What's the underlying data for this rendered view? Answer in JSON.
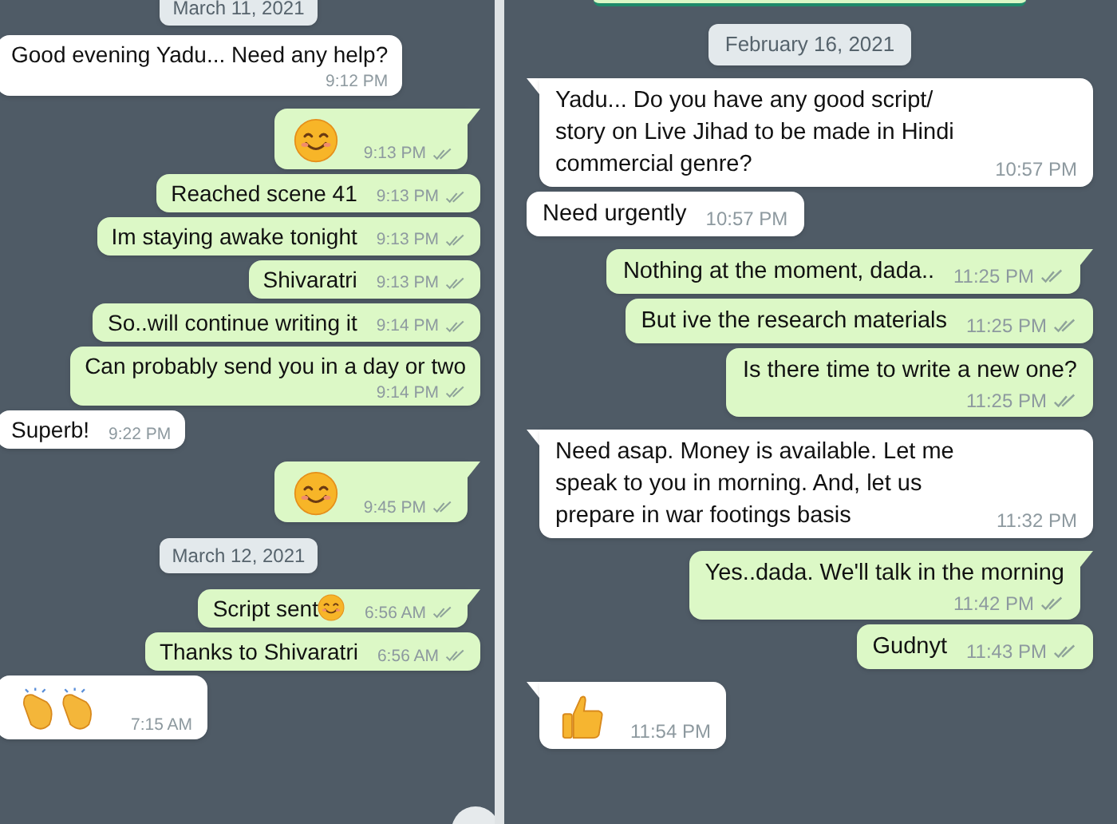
{
  "chats": [
    {
      "messages": [
        {
          "kind": "date",
          "text": "March 11, 2021"
        },
        {
          "kind": "text",
          "text": "Good evening Yadu... Need any help?",
          "time": "9:12 PM",
          "outgoing": false,
          "tail": false,
          "time_below": true
        },
        {
          "kind": "smiley",
          "time": "9:13 PM",
          "outgoing": true,
          "tail": true
        },
        {
          "kind": "text",
          "text": "Reached scene 41",
          "time": "9:13 PM",
          "outgoing": true,
          "tail": false,
          "time_below": false
        },
        {
          "kind": "text",
          "text": "Im staying awake tonight",
          "time": "9:13 PM",
          "outgoing": true,
          "tail": false,
          "time_below": false
        },
        {
          "kind": "text",
          "text": "Shivaratri",
          "time": "9:13 PM",
          "outgoing": true,
          "tail": false,
          "time_below": false
        },
        {
          "kind": "text",
          "text": "So..will continue writing it",
          "time": "9:14 PM",
          "outgoing": true,
          "tail": false,
          "time_below": false
        },
        {
          "kind": "text",
          "text": "Can probably send you in a day or two",
          "time": "9:14 PM",
          "outgoing": true,
          "tail": false,
          "time_below": true
        },
        {
          "kind": "text",
          "text": "Superb!",
          "time": "9:22 PM",
          "outgoing": false,
          "tail": false,
          "time_below": false
        },
        {
          "kind": "smiley",
          "time": "9:45 PM",
          "outgoing": true,
          "tail": true
        },
        {
          "kind": "date",
          "text": "March 12, 2021"
        },
        {
          "kind": "text",
          "text": "Script sent",
          "trailing_smiley": true,
          "time": "6:56 AM",
          "outgoing": true,
          "tail": true,
          "time_below": false
        },
        {
          "kind": "text",
          "text": "Thanks to Shivaratri",
          "time": "6:56 AM",
          "outgoing": true,
          "tail": false,
          "time_below": false
        },
        {
          "kind": "clapping",
          "time": "7:15 AM",
          "outgoing": false,
          "tail": false
        }
      ]
    },
    {
      "messages": [
        {
          "kind": "date",
          "text": "February 16, 2021"
        },
        {
          "kind": "text",
          "text": "Yadu... Do you have any good script/ story on Live Jihad to be made in Hindi commercial genre?",
          "time": "10:57 PM",
          "outgoing": false,
          "tail": true,
          "time_below": false
        },
        {
          "kind": "text",
          "text": "Need urgently",
          "time": "10:57 PM",
          "outgoing": false,
          "tail": false,
          "time_below": false
        },
        {
          "kind": "text",
          "text": "Nothing at the moment, dada..",
          "time": "11:25 PM",
          "outgoing": true,
          "tail": true,
          "time_below": false
        },
        {
          "kind": "text",
          "text": "But ive the research materials",
          "time": "11:25 PM",
          "outgoing": true,
          "tail": false,
          "time_below": false
        },
        {
          "kind": "text",
          "text": "Is there time to write a new one?",
          "time": "11:25 PM",
          "outgoing": true,
          "tail": false,
          "time_below": true
        },
        {
          "kind": "text",
          "text": "Need asap. Money is available. Let me speak to you in morning. And, let us prepare in war footings basis",
          "time": "11:32 PM",
          "outgoing": false,
          "tail": true,
          "time_below": false
        },
        {
          "kind": "text",
          "text": "Yes..dada. We'll talk in the morning",
          "time": "11:42 PM",
          "outgoing": true,
          "tail": true,
          "time_below": true
        },
        {
          "kind": "text",
          "text": "Gudnyt",
          "time": "11:43 PM",
          "outgoing": true,
          "tail": false,
          "time_below": false
        },
        {
          "kind": "thumbsup",
          "time": "11:54 PM",
          "outgoing": false,
          "tail": true
        }
      ]
    }
  ]
}
